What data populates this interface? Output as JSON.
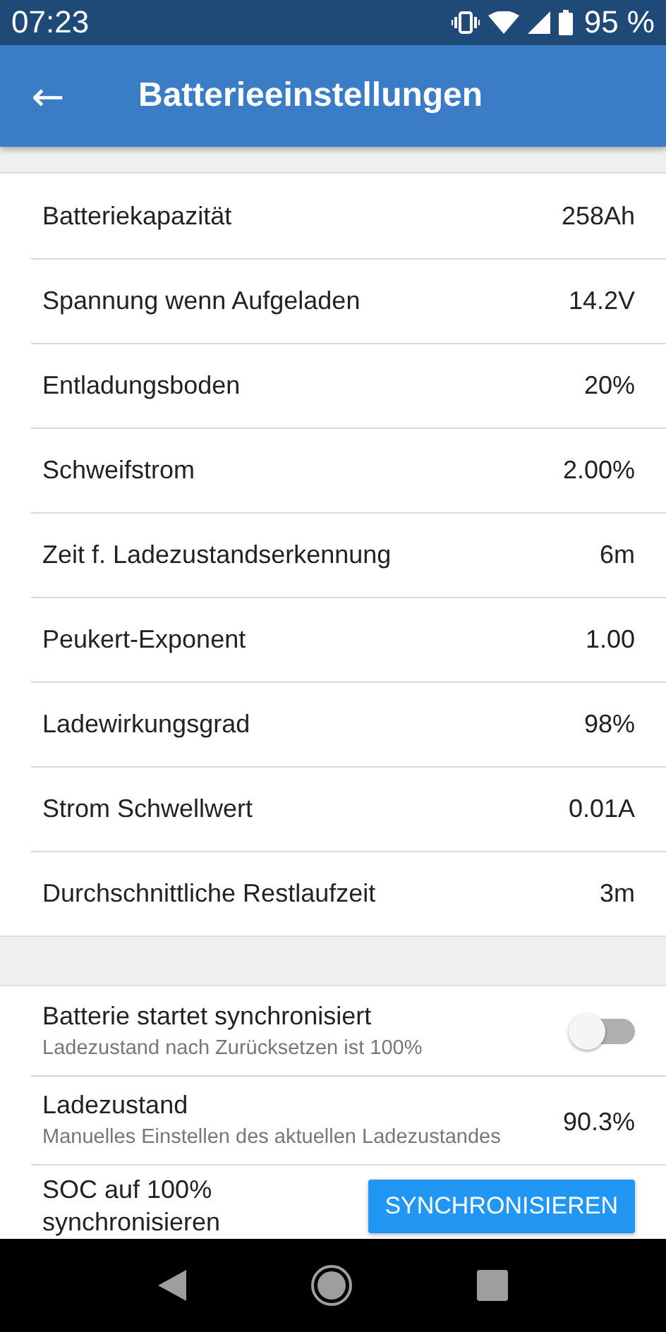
{
  "status_bar": {
    "time": "07:23",
    "battery_percent": "95 %"
  },
  "app_bar": {
    "back_icon": "←",
    "title": "Batterieeinstellungen"
  },
  "settings": [
    {
      "label": "Batteriekapazität",
      "value": "258Ah"
    },
    {
      "label": "Spannung wenn Aufgeladen",
      "value": "14.2V"
    },
    {
      "label": "Entladungsboden",
      "value": "20%"
    },
    {
      "label": "Schweifstrom",
      "value": "2.00%"
    },
    {
      "label": "Zeit f. Ladezustandserkennung",
      "value": "6m"
    },
    {
      "label": "Peukert-Exponent",
      "value": "1.00"
    },
    {
      "label": "Ladewirkungsgrad",
      "value": "98%"
    },
    {
      "label": "Strom Schwellwert",
      "value": "0.01A"
    },
    {
      "label": "Durchschnittliche Restlaufzeit",
      "value": "3m"
    }
  ],
  "sync_settings": [
    {
      "kind": "switch",
      "label": "Batterie startet synchronisiert",
      "description": "Ladezustand nach Zurücksetzen ist 100%",
      "on": false
    },
    {
      "kind": "value",
      "label": "Ladezustand",
      "description": "Manuelles Einstellen des aktuellen Ladezustandes",
      "value": "90.3%"
    },
    {
      "kind": "button",
      "label": "SOC auf 100% synchronisieren",
      "button": "SYNCHRONISIEREN"
    }
  ]
}
